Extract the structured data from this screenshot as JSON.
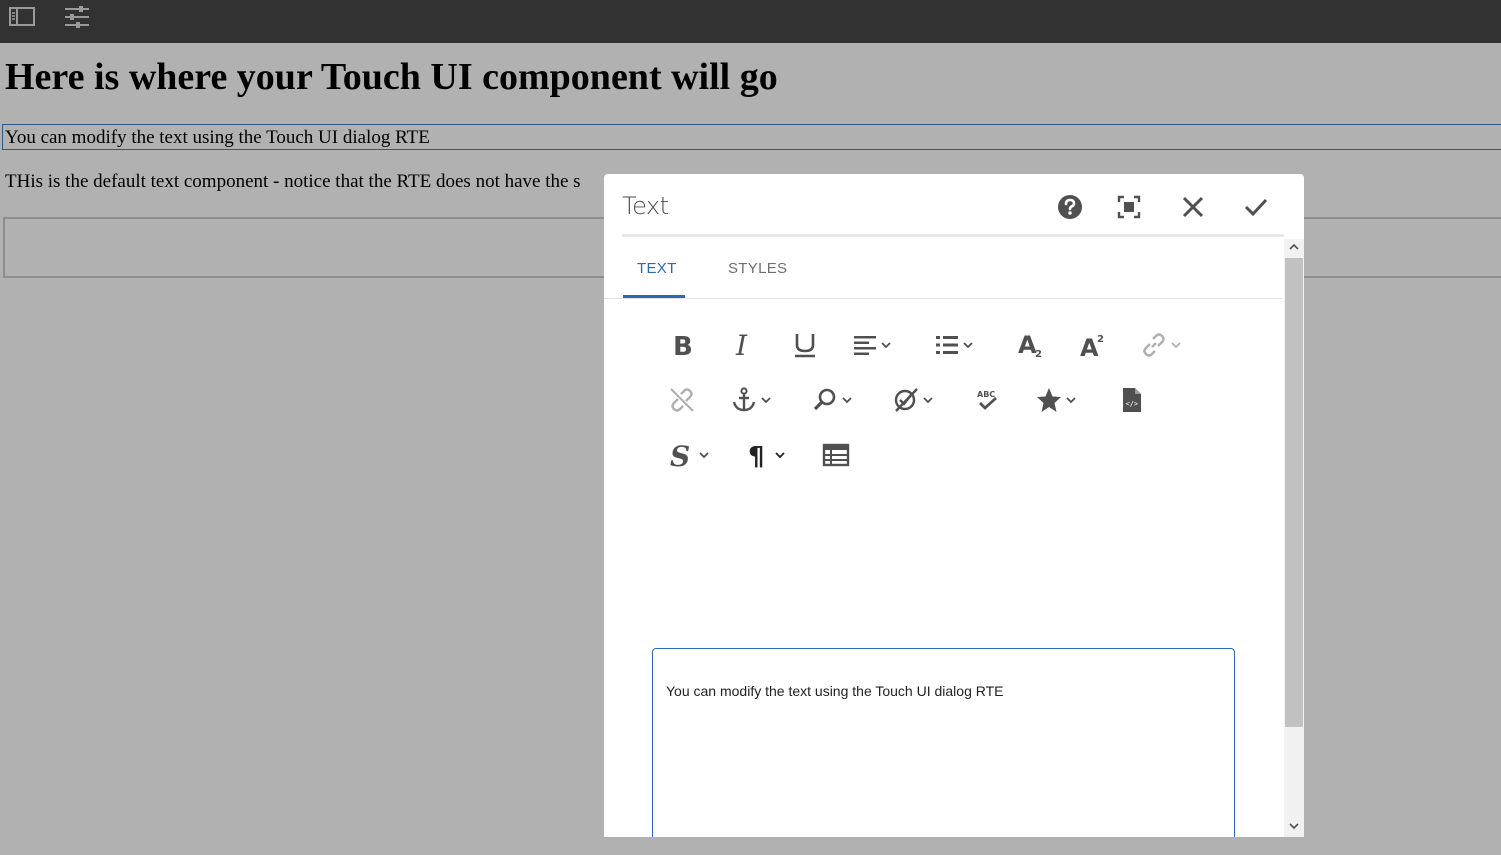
{
  "topbar": {
    "icons": [
      "side-panel-icon",
      "properties-icon"
    ]
  },
  "page": {
    "heading": "Here is where your Touch UI component will go",
    "editable_text": "You can modify the text using the Touch UI dialog RTE",
    "default_text": "THis is the default text component - notice that the RTE does not have the s"
  },
  "dialog": {
    "title": "Text",
    "buttons": [
      "help-icon",
      "fullscreen-icon",
      "close-icon",
      "check-icon"
    ],
    "tabs": [
      {
        "label": "TEXT",
        "active": true
      },
      {
        "label": "STYLES",
        "active": false
      }
    ],
    "toolbar": {
      "row1": [
        "bold-icon",
        "italic-icon",
        "underline-icon",
        "justify-icon",
        "list-icon",
        "subscript-icon",
        "superscript-icon",
        "link-icon"
      ],
      "row2": [
        "unlink-icon",
        "anchor-icon",
        "find-replace-icon",
        "spellcheck-remove-icon",
        "spellcheck-icon",
        "special-characters-icon",
        "source-edit-icon"
      ],
      "row3": [
        "styles-icon",
        "paragraph-format-icon",
        "table-icon"
      ]
    },
    "rte_content": "You can modify the text using the Touch UI dialog RTE"
  },
  "colors": {
    "page_background": "#b1b1b1",
    "topbar": "#323232",
    "accent": "#2b6ab3",
    "icon": "#505050"
  }
}
